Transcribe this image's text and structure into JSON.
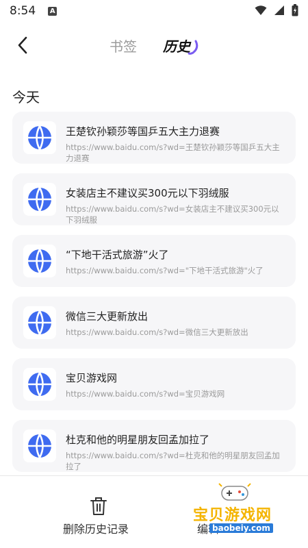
{
  "status_bar": {
    "time": "8:54",
    "notif_letter": "A"
  },
  "tabs": {
    "bookmarks": "书签",
    "history": "历史"
  },
  "section": {
    "title": "今天"
  },
  "history_items": [
    {
      "title": "王楚钦孙颖莎等国乒五大主力退赛",
      "url": "https://www.baidu.com/s?wd=王楚钦孙颖莎等国乒五大主力退赛"
    },
    {
      "title": "女装店主不建议买300元以下羽绒服",
      "url": "https://www.baidu.com/s?wd=女装店主不建议买300元以下羽绒服"
    },
    {
      "title": "“下地干活式旅游”火了",
      "url": "https://www.baidu.com/s?wd=\"下地干活式旅游\"火了"
    },
    {
      "title": "微信三大更新放出",
      "url": "https://www.baidu.com/s?wd=微信三大更新放出"
    },
    {
      "title": "宝贝游戏网",
      "url": "https://www.baidu.com/s?wd=宝贝游戏网"
    },
    {
      "title": "杜克和他的明星朋友回孟加拉了",
      "url": "https://www.baidu.com/s?wd=杜克和他的明星朋友回孟加拉了"
    }
  ],
  "bottom": {
    "delete_label": "删除历史记录",
    "edit_label": "编辑"
  },
  "watermark": {
    "title": "宝贝游戏网",
    "url": "baobeiy.com"
  },
  "colors": {
    "accent": "#3f6bf0",
    "tab_indicator": "#7a5cf0"
  }
}
